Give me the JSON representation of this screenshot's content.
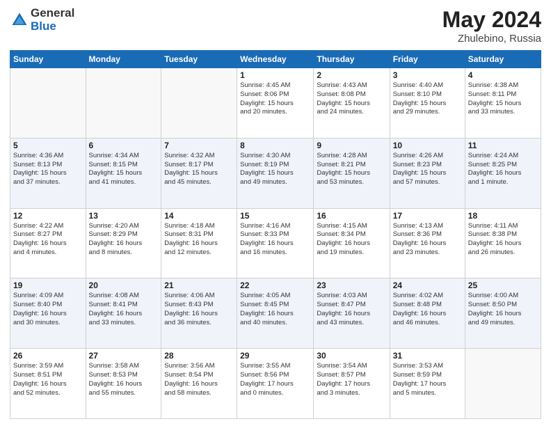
{
  "logo": {
    "general": "General",
    "blue": "Blue"
  },
  "title": {
    "month": "May 2024",
    "location": "Zhulebino, Russia"
  },
  "headers": [
    "Sunday",
    "Monday",
    "Tuesday",
    "Wednesday",
    "Thursday",
    "Friday",
    "Saturday"
  ],
  "weeks": [
    [
      {
        "num": "",
        "info": ""
      },
      {
        "num": "",
        "info": ""
      },
      {
        "num": "",
        "info": ""
      },
      {
        "num": "1",
        "info": "Sunrise: 4:45 AM\nSunset: 8:06 PM\nDaylight: 15 hours\nand 20 minutes."
      },
      {
        "num": "2",
        "info": "Sunrise: 4:43 AM\nSunset: 8:08 PM\nDaylight: 15 hours\nand 24 minutes."
      },
      {
        "num": "3",
        "info": "Sunrise: 4:40 AM\nSunset: 8:10 PM\nDaylight: 15 hours\nand 29 minutes."
      },
      {
        "num": "4",
        "info": "Sunrise: 4:38 AM\nSunset: 8:11 PM\nDaylight: 15 hours\nand 33 minutes."
      }
    ],
    [
      {
        "num": "5",
        "info": "Sunrise: 4:36 AM\nSunset: 8:13 PM\nDaylight: 15 hours\nand 37 minutes."
      },
      {
        "num": "6",
        "info": "Sunrise: 4:34 AM\nSunset: 8:15 PM\nDaylight: 15 hours\nand 41 minutes."
      },
      {
        "num": "7",
        "info": "Sunrise: 4:32 AM\nSunset: 8:17 PM\nDaylight: 15 hours\nand 45 minutes."
      },
      {
        "num": "8",
        "info": "Sunrise: 4:30 AM\nSunset: 8:19 PM\nDaylight: 15 hours\nand 49 minutes."
      },
      {
        "num": "9",
        "info": "Sunrise: 4:28 AM\nSunset: 8:21 PM\nDaylight: 15 hours\nand 53 minutes."
      },
      {
        "num": "10",
        "info": "Sunrise: 4:26 AM\nSunset: 8:23 PM\nDaylight: 15 hours\nand 57 minutes."
      },
      {
        "num": "11",
        "info": "Sunrise: 4:24 AM\nSunset: 8:25 PM\nDaylight: 16 hours\nand 1 minute."
      }
    ],
    [
      {
        "num": "12",
        "info": "Sunrise: 4:22 AM\nSunset: 8:27 PM\nDaylight: 16 hours\nand 4 minutes."
      },
      {
        "num": "13",
        "info": "Sunrise: 4:20 AM\nSunset: 8:29 PM\nDaylight: 16 hours\nand 8 minutes."
      },
      {
        "num": "14",
        "info": "Sunrise: 4:18 AM\nSunset: 8:31 PM\nDaylight: 16 hours\nand 12 minutes."
      },
      {
        "num": "15",
        "info": "Sunrise: 4:16 AM\nSunset: 8:33 PM\nDaylight: 16 hours\nand 16 minutes."
      },
      {
        "num": "16",
        "info": "Sunrise: 4:15 AM\nSunset: 8:34 PM\nDaylight: 16 hours\nand 19 minutes."
      },
      {
        "num": "17",
        "info": "Sunrise: 4:13 AM\nSunset: 8:36 PM\nDaylight: 16 hours\nand 23 minutes."
      },
      {
        "num": "18",
        "info": "Sunrise: 4:11 AM\nSunset: 8:38 PM\nDaylight: 16 hours\nand 26 minutes."
      }
    ],
    [
      {
        "num": "19",
        "info": "Sunrise: 4:09 AM\nSunset: 8:40 PM\nDaylight: 16 hours\nand 30 minutes."
      },
      {
        "num": "20",
        "info": "Sunrise: 4:08 AM\nSunset: 8:41 PM\nDaylight: 16 hours\nand 33 minutes."
      },
      {
        "num": "21",
        "info": "Sunrise: 4:06 AM\nSunset: 8:43 PM\nDaylight: 16 hours\nand 36 minutes."
      },
      {
        "num": "22",
        "info": "Sunrise: 4:05 AM\nSunset: 8:45 PM\nDaylight: 16 hours\nand 40 minutes."
      },
      {
        "num": "23",
        "info": "Sunrise: 4:03 AM\nSunset: 8:47 PM\nDaylight: 16 hours\nand 43 minutes."
      },
      {
        "num": "24",
        "info": "Sunrise: 4:02 AM\nSunset: 8:48 PM\nDaylight: 16 hours\nand 46 minutes."
      },
      {
        "num": "25",
        "info": "Sunrise: 4:00 AM\nSunset: 8:50 PM\nDaylight: 16 hours\nand 49 minutes."
      }
    ],
    [
      {
        "num": "26",
        "info": "Sunrise: 3:59 AM\nSunset: 8:51 PM\nDaylight: 16 hours\nand 52 minutes."
      },
      {
        "num": "27",
        "info": "Sunrise: 3:58 AM\nSunset: 8:53 PM\nDaylight: 16 hours\nand 55 minutes."
      },
      {
        "num": "28",
        "info": "Sunrise: 3:56 AM\nSunset: 8:54 PM\nDaylight: 16 hours\nand 58 minutes."
      },
      {
        "num": "29",
        "info": "Sunrise: 3:55 AM\nSunset: 8:56 PM\nDaylight: 17 hours\nand 0 minutes."
      },
      {
        "num": "30",
        "info": "Sunrise: 3:54 AM\nSunset: 8:57 PM\nDaylight: 17 hours\nand 3 minutes."
      },
      {
        "num": "31",
        "info": "Sunrise: 3:53 AM\nSunset: 8:59 PM\nDaylight: 17 hours\nand 5 minutes."
      },
      {
        "num": "",
        "info": ""
      }
    ]
  ]
}
